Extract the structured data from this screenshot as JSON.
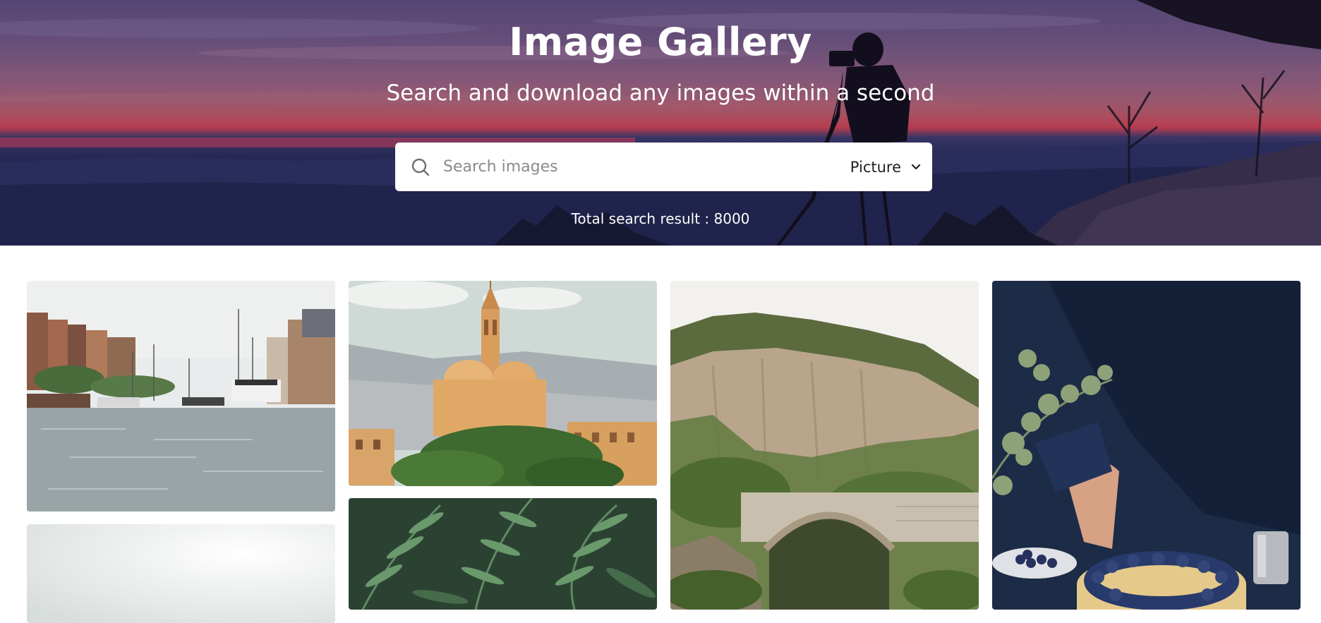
{
  "hero": {
    "title": "Image Gallery",
    "subtitle": "Search and download any images within a second"
  },
  "search": {
    "placeholder": "Search images",
    "value": "",
    "icon": "search-icon",
    "type_selected": "Picture",
    "type_icon": "chevron-down-icon"
  },
  "results": {
    "total_label": "Total search result : 8000"
  },
  "gallery": {
    "images": [
      {
        "subject": "canal-harbor",
        "column": 1
      },
      {
        "subject": "hazy-white",
        "column": 1
      },
      {
        "subject": "domed-church",
        "column": 2
      },
      {
        "subject": "fern-leaves",
        "column": 2
      },
      {
        "subject": "cliff-stone-bridge",
        "column": 3
      },
      {
        "subject": "blueberry-cake",
        "column": 4
      }
    ]
  },
  "colors": {
    "hero_sky_top": "#5d4d7e",
    "hero_horizon": "#c64256",
    "hero_ground": "#20234a",
    "search_bg": "#ffffff",
    "page_bg": "#ffffff"
  }
}
